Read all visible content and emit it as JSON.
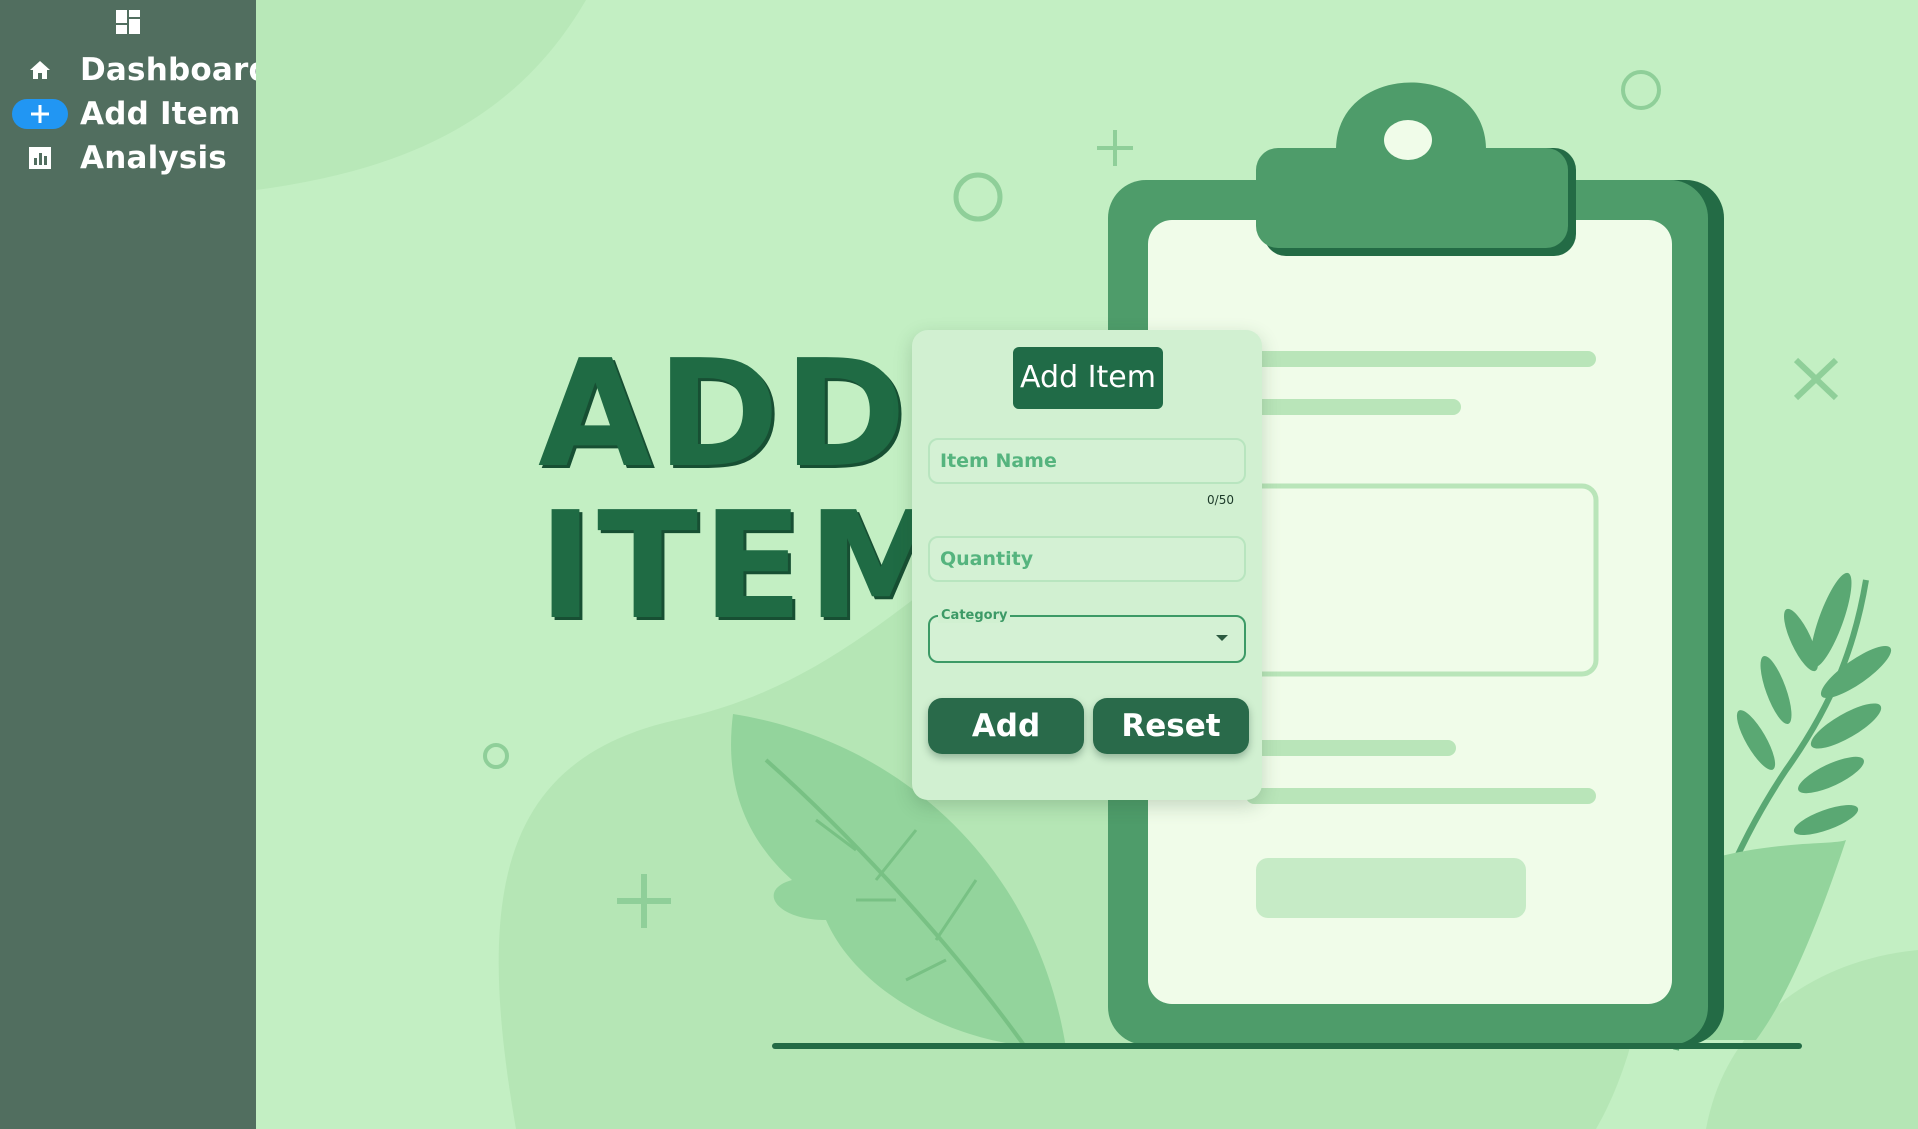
{
  "sidebar": {
    "logo_icon": "dashboard-grid-icon",
    "items": [
      {
        "label": "Dashboard",
        "icon": "home-icon",
        "active": false
      },
      {
        "label": "Add Item",
        "icon": "plus-icon",
        "active": true
      },
      {
        "label": "Analysis",
        "icon": "bar-chart-icon",
        "active": false
      }
    ]
  },
  "hero": {
    "line1": "ADD",
    "line2": "ITEM"
  },
  "form": {
    "title": "Add Item",
    "item_name_placeholder": "Item Name",
    "item_name_value": "",
    "item_name_counter": "0/50",
    "quantity_placeholder": "Quantity",
    "quantity_value": "",
    "category_label": "Category",
    "category_value": "",
    "add_label": "Add",
    "reset_label": "Reset"
  },
  "colors": {
    "sidebar_bg": "#516e5f",
    "active_pill": "#2196f3",
    "page_bg": "#c3efc3",
    "brand_green": "#206b47"
  }
}
